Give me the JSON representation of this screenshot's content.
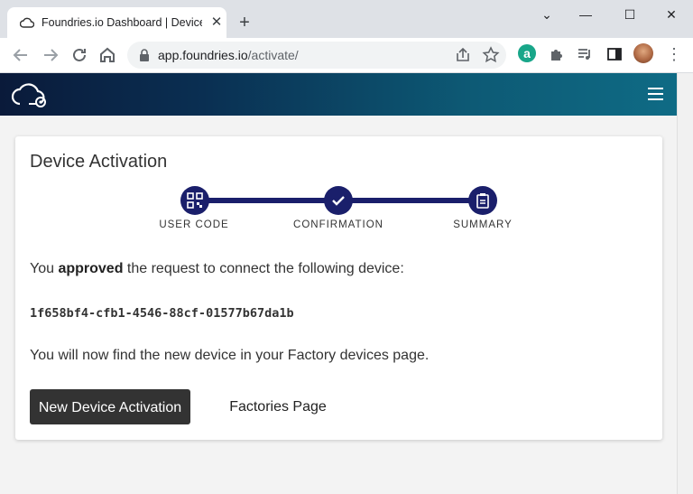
{
  "browser": {
    "tab_title": "Foundries.io Dashboard | Device",
    "url_host": "app.foundries.io",
    "url_path": "/activate/",
    "extension_letter": "a"
  },
  "page": {
    "title": "Device Activation",
    "steps": [
      {
        "label": "USER CODE",
        "icon": "qr-code-icon"
      },
      {
        "label": "CONFIRMATION",
        "icon": "check-icon"
      },
      {
        "label": "SUMMARY",
        "icon": "clipboard-icon"
      }
    ],
    "message_prefix": "You ",
    "message_bold": "approved",
    "message_suffix": " the request to connect the following device:",
    "device_id": "1f658bf4-cfb1-4546-88cf-01577b67da1b",
    "followup": "You will now find the new device in your Factory devices page.",
    "primary_button": "New Device Activation",
    "secondary_button": "Factories Page"
  },
  "colors": {
    "accent": "#1a1f6b",
    "header_start": "#0a1a3a",
    "header_end": "#0f6b85"
  }
}
